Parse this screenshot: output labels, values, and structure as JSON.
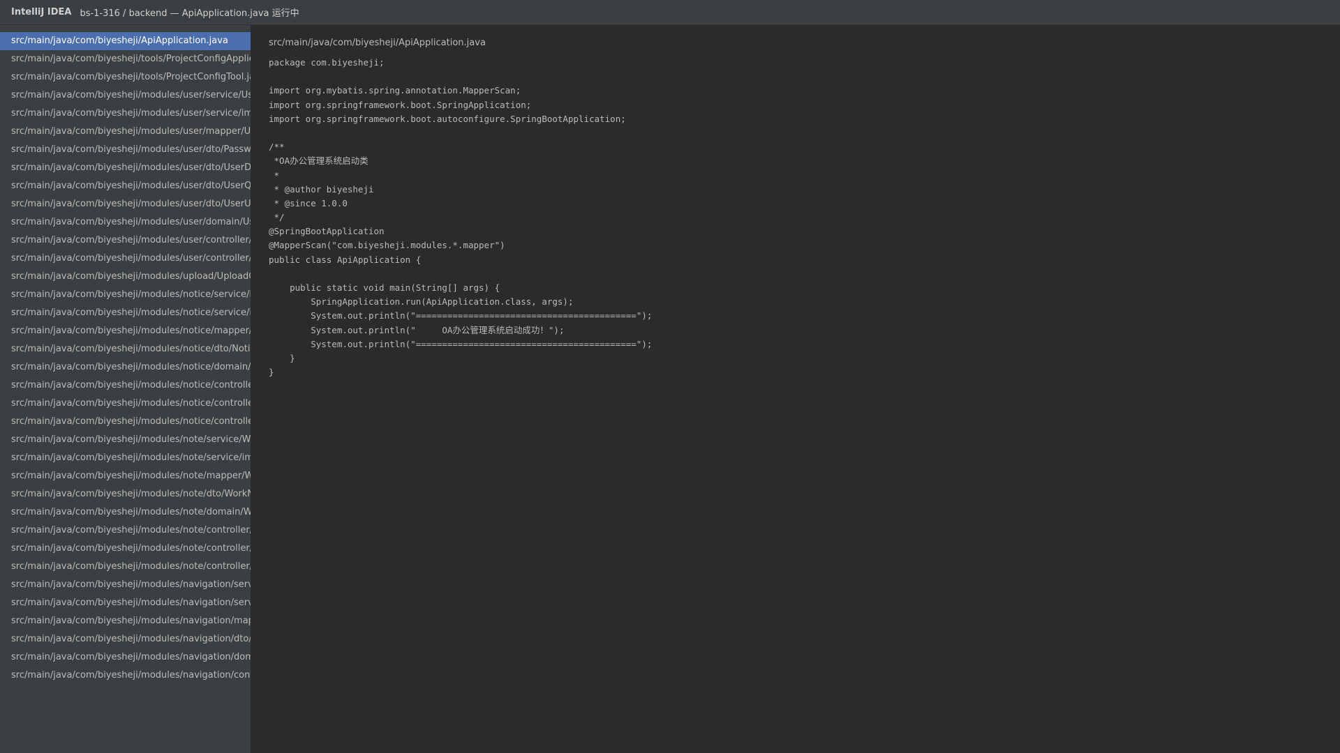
{
  "titlebar": {
    "app_name": "IntelliJ IDEA",
    "project_path": "bs-1-316 / backend — ApiApplication.java 运行中"
  },
  "sidebar": {
    "files": [
      {
        "label": "src/main/java/com/biyesheji/ApiApplication.java",
        "selected": true
      },
      {
        "label": "src/main/java/com/biyesheji/tools/ProjectConfigApplier.java",
        "selected": false
      },
      {
        "label": "src/main/java/com/biyesheji/tools/ProjectConfigTool.java",
        "selected": false
      },
      {
        "label": "src/main/java/com/biyesheji/modules/user/service/UserService.java",
        "selected": false
      },
      {
        "label": "src/main/java/com/biyesheji/modules/user/service/impl/UserServiceImpl.java",
        "selected": false
      },
      {
        "label": "src/main/java/com/biyesheji/modules/user/mapper/UserMapper.java",
        "selected": false
      },
      {
        "label": "src/main/java/com/biyesheji/modules/user/dto/PasswordDTO.java",
        "selected": false
      },
      {
        "label": "src/main/java/com/biyesheji/modules/user/dto/UserDTO.java",
        "selected": false
      },
      {
        "label": "src/main/java/com/biyesheji/modules/user/dto/UserQueryDTO.java",
        "selected": false
      },
      {
        "label": "src/main/java/com/biyesheji/modules/user/dto/UserUpdateDTO.java",
        "selected": false
      },
      {
        "label": "src/main/java/com/biyesheji/modules/user/domain/User.java",
        "selected": false
      },
      {
        "label": "src/main/java/com/biyesheji/modules/user/controller/UserController.java",
        "selected": false
      },
      {
        "label": "src/main/java/com/biyesheji/modules/user/controller/UserAdminController.java",
        "selected": false
      },
      {
        "label": "src/main/java/com/biyesheji/modules/upload/UploadController.java",
        "selected": false
      },
      {
        "label": "src/main/java/com/biyesheji/modules/notice/service/NoticeService.java",
        "selected": false
      },
      {
        "label": "src/main/java/com/biyesheji/modules/notice/service/impl/NoticeServiceImpl.java",
        "selected": false
      },
      {
        "label": "src/main/java/com/biyesheji/modules/notice/mapper/NoticeMapper.java",
        "selected": false
      },
      {
        "label": "src/main/java/com/biyesheji/modules/notice/dto/NoticeDTO.java",
        "selected": false
      },
      {
        "label": "src/main/java/com/biyesheji/modules/notice/domain/Notice.java",
        "selected": false
      },
      {
        "label": "src/main/java/com/biyesheji/modules/notice/controller/AdminNoticeController.java",
        "selected": false
      },
      {
        "label": "src/main/java/com/biyesheji/modules/notice/controller/NoticeController.java",
        "selected": false
      },
      {
        "label": "src/main/java/com/biyesheji/modules/notice/controller/UserNoticeController.java",
        "selected": false
      },
      {
        "label": "src/main/java/com/biyesheji/modules/note/service/WorkNoteService.java",
        "selected": false
      },
      {
        "label": "src/main/java/com/biyesheji/modules/note/service/impl/WorkNoteServiceImpl.java",
        "selected": false
      },
      {
        "label": "src/main/java/com/biyesheji/modules/note/mapper/WorkNoteMapper.java",
        "selected": false
      },
      {
        "label": "src/main/java/com/biyesheji/modules/note/dto/WorkNoteDTO.java",
        "selected": false
      },
      {
        "label": "src/main/java/com/biyesheji/modules/note/domain/WorkNote.java",
        "selected": false
      },
      {
        "label": "src/main/java/com/biyesheji/modules/note/controller/AdminWorkNoteController.java",
        "selected": false
      },
      {
        "label": "src/main/java/com/biyesheji/modules/note/controller/MyWorkNoteController.java",
        "selected": false
      },
      {
        "label": "src/main/java/com/biyesheji/modules/note/controller/UserWorkNoteController.java",
        "selected": false
      },
      {
        "label": "src/main/java/com/biyesheji/modules/navigation/service/NavigationService.java",
        "selected": false
      },
      {
        "label": "src/main/java/com/biyesheji/modules/navigation/service/impl/NavigationServiceImpl.java",
        "selected": false
      },
      {
        "label": "src/main/java/com/biyesheji/modules/navigation/mapper/NavigationMapper.java",
        "selected": false
      },
      {
        "label": "src/main/java/com/biyesheji/modules/navigation/dto/NavigationDTO.java",
        "selected": false
      },
      {
        "label": "src/main/java/com/biyesheji/modules/navigation/domain/Navigation.java",
        "selected": false
      },
      {
        "label": "src/main/java/com/biyesheji/modules/navigation/controller/NavigationController.java",
        "selected": false
      }
    ]
  },
  "editor": {
    "file_path": "src/main/java/com/biyesheji/ApiApplication.java",
    "code_lines": [
      "package com.biyesheji;",
      "",
      "import org.mybatis.spring.annotation.MapperScan;",
      "import org.springframework.boot.SpringApplication;",
      "import org.springframework.boot.autoconfigure.SpringBootApplication;",
      "",
      "/**",
      " *OA办公管理系统启动类",
      " *",
      " * @author biyesheji",
      " * @since 1.0.0",
      " */",
      "@SpringBootApplication",
      "@MapperScan(\"com.biyesheji.modules.*.mapper\")",
      "public class ApiApplication {",
      "",
      "    public static void main(String[] args) {",
      "        SpringApplication.run(ApiApplication.class, args);",
      "        System.out.println(\"==========================================\");",
      "        System.out.println(\"     OA办公管理系统启动成功！\");",
      "        System.out.println(\"==========================================\");",
      "    }",
      "}"
    ]
  }
}
